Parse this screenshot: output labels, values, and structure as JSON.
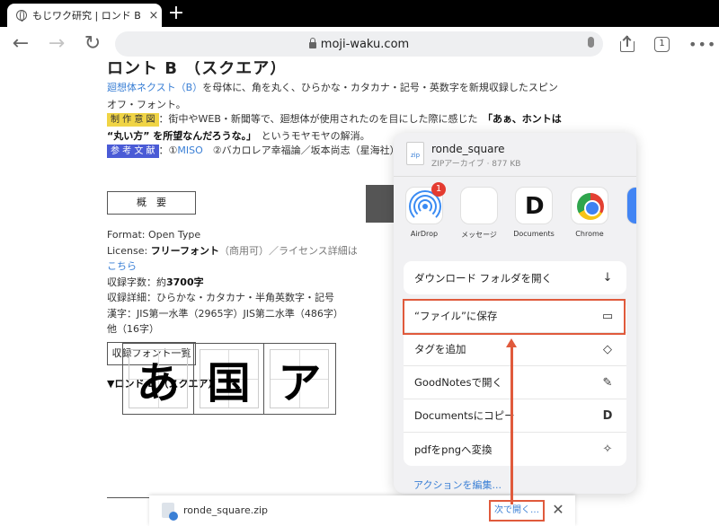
{
  "browser": {
    "tab_title": "もじワク研究 | ロンド B （スクエア）",
    "tab_close": "×",
    "new_tab": "+",
    "url": "moji-waku.com",
    "tab_count": "1",
    "back_glyph": "←",
    "forward_glyph": "→",
    "reload_glyph": "↻",
    "more_glyph": "•••"
  },
  "page": {
    "title": "ロント B （スクエア）",
    "intro_link": "廻想体ネクスト（B）",
    "intro_rest": "を母体に、角を丸く、ひらかな・カタカナ・記号・英数字を新規収録したスピン",
    "intro_line2": "オフ・フォント。",
    "intent_tag": "制 作 意 図",
    "intent_text": "：街中やWEB・新聞等で、廻想体が使用されたのを目にした際に感じた　",
    "intent_bold": "「あぁ、ホントは",
    "intent_line2_bold": "“丸い方” を所望なんだろうな。」",
    "intent_line2_rest": "　というモヤモヤの解消。",
    "ref_tag": "参 考 文 献",
    "ref_colon": "：①",
    "ref_link": "MISO",
    "ref_rest": "　②バカロレア幸福論／坂本尚志（星海社）",
    "overview_button": "概　要",
    "format": "Format: Open Type",
    "license_label": "License: ",
    "license_bold": "フリーフォント",
    "license_rest": "（商用可）／ライセンス詳細は",
    "license_link": "こちら",
    "count_label": "収録字数：約",
    "count_bold": "3700字",
    "detail": "収録詳細：ひらかな・カタカナ・半角英数字・記号",
    "kanji": "漢字：JIS第一水準（2965字）JIS第二水準（486字）",
    "other": "他（16字）",
    "list_button": "収録フォント一覧",
    "sample_heading": "▼ロンド B （スクエア）",
    "glyphs": [
      "あ",
      "国",
      "ア"
    ]
  },
  "download_bar": {
    "filename": "ronde_square.zip",
    "open_label": "次で開く…",
    "close": "✕"
  },
  "share_sheet": {
    "file_name": "ronde_square",
    "file_meta": "ZIPアーカイブ · 877 KB",
    "zip_label": "zip",
    "apps": [
      {
        "label": "AirDrop",
        "badge": "1"
      },
      {
        "label": "メッセージ"
      },
      {
        "label": "Documents"
      },
      {
        "label": "Chrome"
      }
    ],
    "actions_top": [
      {
        "label": "ダウンロード フォルダを開く",
        "icon": "download-icon",
        "glyph": "↓"
      }
    ],
    "actions": [
      {
        "label": "“ファイル”に保存",
        "icon": "folder-icon",
        "glyph": "▭"
      },
      {
        "label": "タグを追加",
        "icon": "tag-icon",
        "glyph": "◇"
      },
      {
        "label": "GoodNotesで開く",
        "icon": "goodnotes-icon",
        "glyph": "✎"
      },
      {
        "label": "Documentsにコピー",
        "icon": "documents-d-icon",
        "glyph": "D"
      },
      {
        "label": "pdfをpngへ変換",
        "icon": "sparkle-icon",
        "glyph": "✧"
      }
    ],
    "edit_actions": "アクションを編集..."
  },
  "colors": {
    "annotation": "#e05a3c",
    "link": "#3a7fd5"
  }
}
